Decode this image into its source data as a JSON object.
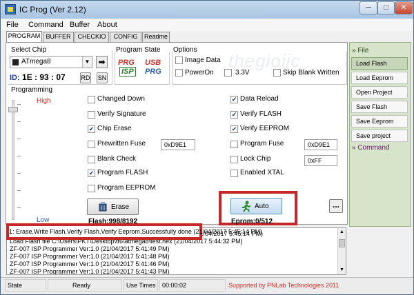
{
  "window": {
    "title": "IC Prog (Ver 2.12)",
    "min": "─",
    "max": "□",
    "close": "✕"
  },
  "menu": [
    "File",
    "Command",
    "Buffer",
    "About"
  ],
  "tabs": [
    "PROGRAM",
    "BUFFER",
    "CHECKIO",
    "CONFIG",
    "Readme"
  ],
  "select_chip": {
    "label": "Select Chip",
    "value": "ATmega8",
    "arrow": "➡"
  },
  "chip_id": {
    "label": "ID:",
    "value": "1E : 93 : 07",
    "rd": "RD",
    "sn": "SN"
  },
  "program_state": {
    "label": "Program State",
    "logo_isp_top": "PRG",
    "logo_isp_bottom": "ISP",
    "logo_usb_top": "USB",
    "logo_usb_bottom": "PRG"
  },
  "options": {
    "label": "Options",
    "image_data": "Image Data",
    "poweron": "PowerOn",
    "v33": "3.3V",
    "skip_blank": "Skip Blank Written"
  },
  "watermark": "thegioiic",
  "programming": {
    "label": "Programming",
    "high": "High",
    "low": "Low",
    "left": [
      {
        "label": "Changed Down",
        "checked": false
      },
      {
        "label": "Verify Signature",
        "checked": false
      },
      {
        "label": "Chip Erase",
        "checked": true
      },
      {
        "label": "Prewritten Fuse",
        "checked": false
      },
      {
        "label": "Blank Check",
        "checked": false
      },
      {
        "label": "Program FLASH",
        "checked": true
      },
      {
        "label": "Program EEPROM",
        "checked": false
      }
    ],
    "right": [
      {
        "label": "Data Reload",
        "checked": true
      },
      {
        "label": "Verify FLASH",
        "checked": true
      },
      {
        "label": "Verify EEPROM",
        "checked": true
      },
      {
        "label": "Program Fuse",
        "checked": false
      },
      {
        "label": "Lock Chip",
        "checked": false
      },
      {
        "label": "Enabled XTAL",
        "checked": false
      }
    ],
    "prewritten_fuse_value": "0xD9E1",
    "program_fuse_value": "0xD9E1",
    "lock_chip_value": "0xFF",
    "erase_label": "Erase",
    "auto_label": "Auto",
    "flash_count": "Flash:998/8192",
    "eprom_count": "Eprom:0/512",
    "more": "..."
  },
  "sidebar": {
    "file_head": "File",
    "command_head": "Command",
    "items": [
      "Load Flash",
      "Load Eeprom",
      "Open Project",
      "Save Flash",
      "Save Eeprom",
      "Save project"
    ]
  },
  "log": [
    "1: Erase,Write Flash,Verify Flash,Verify Eeprom,Successfully done (21/04/2017 5:45:14 PM)",
    "Load Flash file C:\\Users\\PKT\\Desktop\\tt6\\atmega8\\test.hex (21/04/2017 5:44:32 PM)",
    "ZF-007 ISP Programmer Ver:1.0 (21/04/2017 5:41:49 PM)",
    "ZF-007 ISP Programmer Ver:1.0 (21/04/2017 5:41:48 PM)",
    "ZF-007 ISP Programmer Ver:1.0 (21/04/2017 5:41:46 PM)",
    "ZF-007 ISP Programmer Ver:1.0 (21/04/2017 5:41:43 PM)"
  ],
  "status": {
    "state_label": "State",
    "state_value": "Ready",
    "time_label": "Use Times",
    "time_value": "00:00:02",
    "credit": "Supported by PNLab Technologies 2011"
  }
}
